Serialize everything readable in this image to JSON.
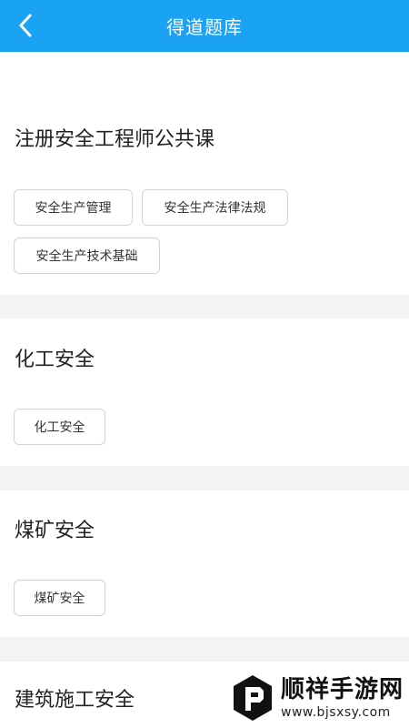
{
  "header": {
    "title": "得道题库",
    "back_icon": "chevron-left-icon",
    "color": "#1aa3f5"
  },
  "sections": [
    {
      "title": "注册安全工程师公共课",
      "items": [
        "安全生产管理",
        "安全生产法律法规",
        "安全生产技术基础"
      ]
    },
    {
      "title": "化工安全",
      "items": [
        "化工安全"
      ]
    },
    {
      "title": "煤矿安全",
      "items": [
        "煤矿安全"
      ]
    },
    {
      "title": "建筑施工安全",
      "items": []
    }
  ],
  "watermark": {
    "logo_icon": "bjsxsy-logo-icon",
    "name": "顺祥手游网",
    "url": "www.bjsxsy.com"
  }
}
